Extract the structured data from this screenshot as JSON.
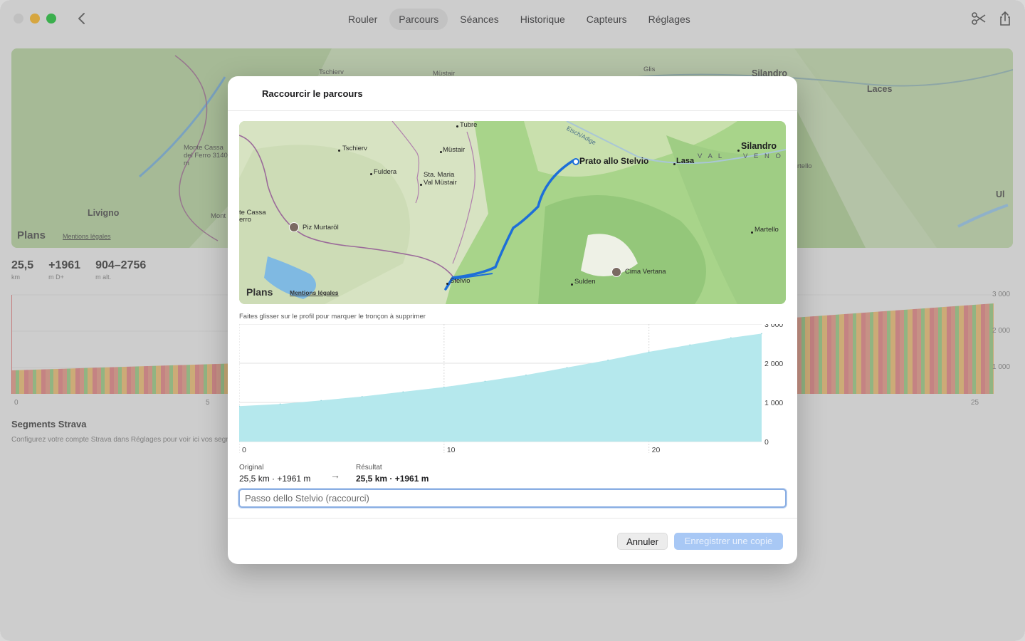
{
  "toolbar": {
    "tabs": [
      "Rouler",
      "Parcours",
      "Séances",
      "Historique",
      "Capteurs",
      "Réglages"
    ],
    "active_tab": "Parcours",
    "icons": {
      "back": "chevron-left-icon",
      "scissors": "scissors-icon",
      "share": "share-icon"
    }
  },
  "background": {
    "map": {
      "labels": [
        "Tschierv",
        "Müstair",
        "Glis",
        "Silandro",
        "Laces",
        "Monte Cassa del Ferro 3140 m",
        "Livigno",
        "Mont",
        "rtello",
        "Ul"
      ],
      "attribution": "Plans",
      "legal": "Mentions légales"
    },
    "stats": [
      {
        "value": "25,5",
        "unit": "km"
      },
      {
        "value": "+1961",
        "unit": "m D+"
      },
      {
        "value": "904–2756",
        "unit": "m alt."
      }
    ],
    "profile_x_ticks": [
      "0",
      "5",
      "25"
    ],
    "profile_y_ticks": [
      "3 000",
      "2 000",
      "1 000"
    ],
    "segments": {
      "title": "Segments Strava",
      "text": "Configurez votre compte Strava dans Réglages pour voir ici vos segments."
    }
  },
  "dialog": {
    "title": "Raccourcir le parcours",
    "map": {
      "labels": {
        "tubre": "Tubre",
        "tschierv": "Tschierv",
        "mustair": "Müstair",
        "fuldera": "Fuldera",
        "sta_maria": "Sta. Maria",
        "val_mustair": "Val Müstair",
        "cassa": "te Cassa",
        "ferro": "erro",
        "piz_murtarol": "Piz Murtaröl",
        "stelvio": "Stelvio",
        "prato": "Prato allo Stelvio",
        "lasa": "Lasa",
        "silandro": "Silandro",
        "val_venosta_1": "V A L",
        "val_venosta_2": "V E N O",
        "etsch": "Etsch/Adige",
        "martello": "Martello",
        "cima_vertana": "Cima Vertana",
        "sulden": "Sulden"
      },
      "attribution": "Plans",
      "legal": "Mentions légales"
    },
    "hint": "Faites glisser sur le profil pour marquer le tronçon à supprimer",
    "chart_data": {
      "type": "area",
      "title": "",
      "xlabel": "",
      "ylabel": "",
      "x": [
        0,
        2,
        4,
        6,
        8,
        10,
        12,
        14,
        16,
        18,
        20,
        22,
        24,
        25.5
      ],
      "values": [
        904,
        960,
        1050,
        1150,
        1270,
        1390,
        1540,
        1700,
        1890,
        2080,
        2290,
        2470,
        2650,
        2756
      ],
      "x_ticks": [
        "0",
        "10",
        "20"
      ],
      "y_ticks": [
        "3 000",
        "2 000",
        "1 000",
        "0"
      ],
      "xlim": [
        0,
        25.5
      ],
      "ylim": [
        0,
        3000
      ],
      "grid": true,
      "fill_color": "#b5e8ed"
    },
    "original": {
      "label": "Original",
      "value": "25,5 km · +1961 m"
    },
    "result": {
      "label": "Résultat",
      "value": "25,5 km · +1961 m"
    },
    "arrow": "→",
    "name_field": {
      "value": "Passo dello Stelvio (raccourci)"
    },
    "buttons": {
      "cancel": "Annuler",
      "save": "Enregistrer une copie"
    }
  }
}
